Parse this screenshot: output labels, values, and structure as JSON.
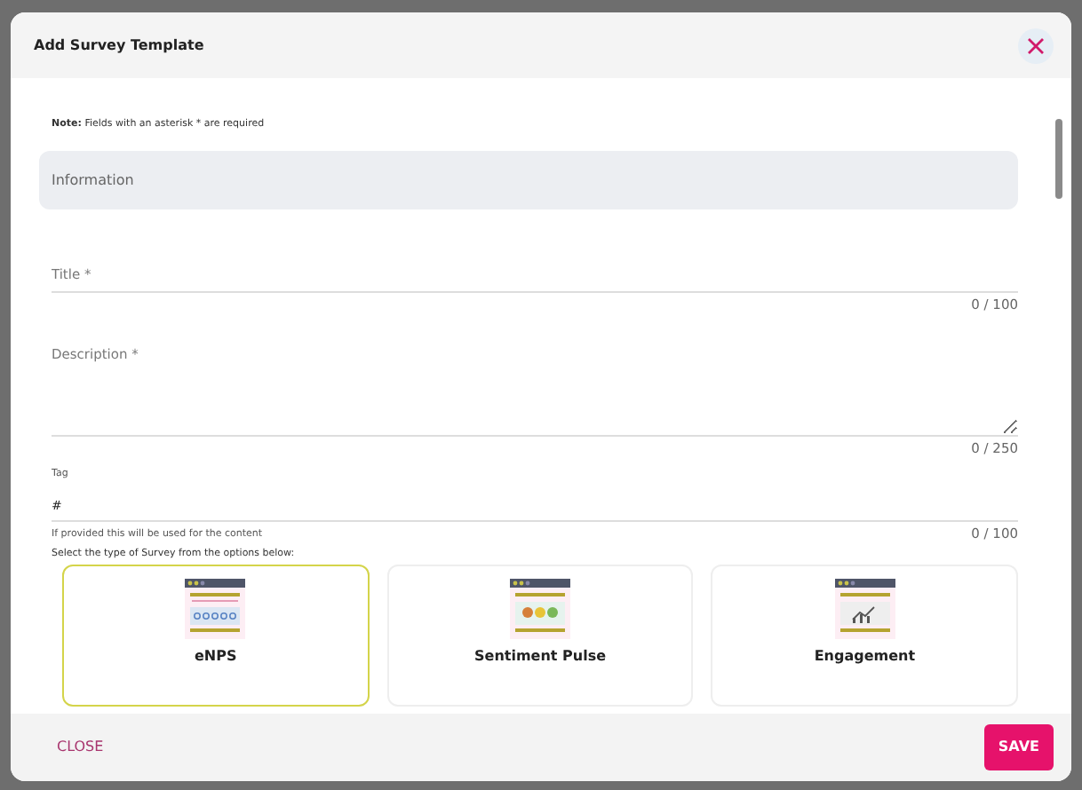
{
  "dialog": {
    "title": "Add Survey Template"
  },
  "note": {
    "label": "Note:",
    "text": "Fields with an asterisk * are required"
  },
  "section": {
    "title": "Information"
  },
  "fields": [
    {
      "kind": "input",
      "placeholder": "Title *",
      "counter": "0 / 100"
    },
    {
      "kind": "textarea",
      "placeholder": "Description *",
      "counter": "0 / 250"
    },
    {
      "kind": "tag",
      "label": "Tag",
      "value": "#",
      "helper": "If provided this will be used for the content",
      "counter": "0 / 100"
    }
  ],
  "survey_types": {
    "prompt": "Select the type of Survey from the options below:",
    "options": [
      {
        "kind": "enps",
        "label": "eNPS",
        "selected": true
      },
      {
        "kind": "sentiment",
        "label": "Sentiment Pulse",
        "selected": false
      },
      {
        "kind": "engagement",
        "label": "Engagement",
        "selected": false
      }
    ]
  },
  "buttons": [
    {
      "kind": "close",
      "label": "CLOSE"
    },
    {
      "kind": "save",
      "label": "SAVE"
    }
  ]
}
